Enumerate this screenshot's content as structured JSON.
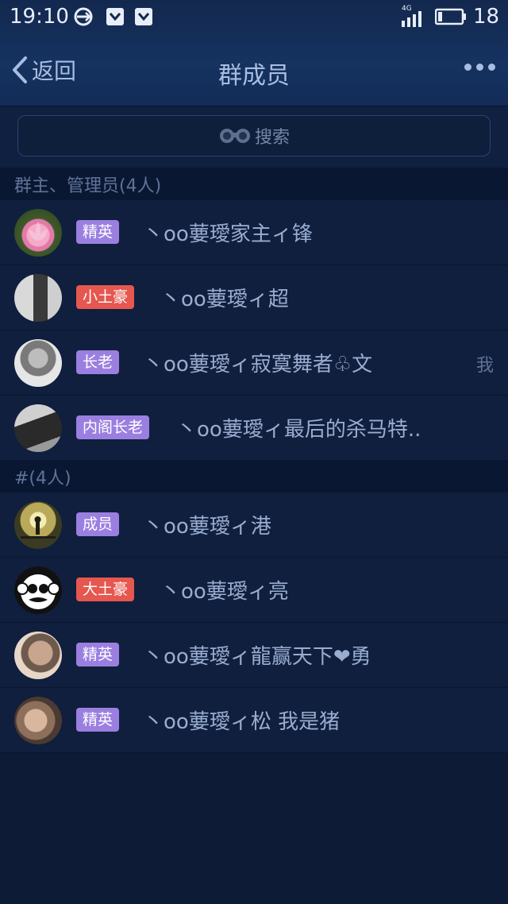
{
  "status": {
    "time": "19:10",
    "network": "4G",
    "battery": "18",
    "left_icons": [
      "sync-icon",
      "shield-icon",
      "shield-icon"
    ]
  },
  "nav": {
    "back_label": "返回",
    "title": "群成员",
    "more_icon": "more-icon"
  },
  "search": {
    "placeholder": "搜索",
    "icon": "binoculars-icon"
  },
  "colors": {
    "badge_purple": "#9b7fe0",
    "badge_red": "#e5574f",
    "background": "#0d1b36"
  },
  "sections": [
    {
      "label": "群主、管理员(4人)",
      "members": [
        {
          "badge": "精英",
          "badge_color": "purple",
          "name": "丶oo葽璦家主ィ锋",
          "avatar": "lotus"
        },
        {
          "badge": "小土豪",
          "badge_color": "red",
          "name": "丶oo葽璦ィ超",
          "avatar": "couple"
        },
        {
          "badge": "长老",
          "badge_color": "purple",
          "name": "丶oo葽璦ィ寂寞舞者♧文",
          "avatar": "soldier",
          "tag": "我"
        },
        {
          "badge": "内阁长老",
          "badge_color": "purple",
          "name": "丶oo葽璦ィ最后的杀马特..",
          "avatar": "bw-person"
        }
      ]
    },
    {
      "label": "#(4人)",
      "members": [
        {
          "badge": "成员",
          "badge_color": "purple",
          "name": "丶oo葽璦ィ港",
          "avatar": "silhouette"
        },
        {
          "badge": "大土豪",
          "badge_color": "red",
          "name": "丶oo葽璦ィ亮",
          "avatar": "monkey"
        },
        {
          "badge": "精英",
          "badge_color": "purple",
          "name": "丶oo葽璦ィ龍赢天下❤勇",
          "avatar": "smoker"
        },
        {
          "badge": "精英",
          "badge_color": "purple",
          "name": "丶oo葽璦ィ松 我是猪",
          "avatar": "kiss"
        }
      ]
    }
  ]
}
